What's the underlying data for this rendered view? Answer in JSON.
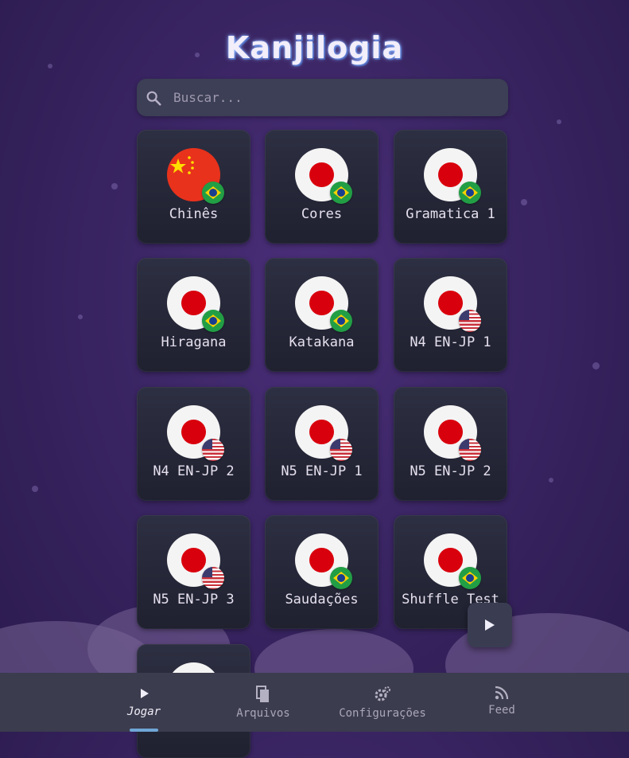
{
  "app": {
    "title": "Kanjilogia"
  },
  "search": {
    "placeholder": "Buscar..."
  },
  "decks": [
    {
      "label": "Chinês",
      "main_flag": "china-flag",
      "badge": "brazil-flag"
    },
    {
      "label": "Cores",
      "main_flag": "japan-flag",
      "badge": "brazil-flag"
    },
    {
      "label": "Gramatica 1",
      "main_flag": "japan-flag",
      "badge": "brazil-flag"
    },
    {
      "label": "Hiragana",
      "main_flag": "japan-flag",
      "badge": "brazil-flag"
    },
    {
      "label": "Katakana",
      "main_flag": "japan-flag",
      "badge": "brazil-flag"
    },
    {
      "label": "N4 EN-JP 1",
      "main_flag": "japan-flag",
      "badge": "usa-flag"
    },
    {
      "label": "N4 EN-JP 2",
      "main_flag": "japan-flag",
      "badge": "usa-flag"
    },
    {
      "label": "N5 EN-JP 1",
      "main_flag": "japan-flag",
      "badge": "usa-flag"
    },
    {
      "label": "N5 EN-JP 2",
      "main_flag": "japan-flag",
      "badge": "usa-flag"
    },
    {
      "label": "N5 EN-JP 3",
      "main_flag": "japan-flag",
      "badge": "usa-flag"
    },
    {
      "label": "Saudações",
      "main_flag": "japan-flag",
      "badge": "brazil-flag"
    },
    {
      "label": "Shuffle Test",
      "main_flag": "japan-flag",
      "badge": "brazil-flag"
    },
    {
      "label": "",
      "main_flag": "japan-flag",
      "badge": ""
    }
  ],
  "fab": {
    "icon": "play-icon"
  },
  "nav": {
    "items": [
      {
        "label": "Jogar",
        "icon": "play-icon",
        "active": true
      },
      {
        "label": "Arquivos",
        "icon": "files-icon",
        "active": false
      },
      {
        "label": "Configurações",
        "icon": "settings-icon",
        "active": false
      },
      {
        "label": "Feed",
        "icon": "rss-icon",
        "active": false
      }
    ]
  },
  "colors": {
    "background": "#3a2563",
    "card": "#262838",
    "navbar": "#3b3c4e",
    "accent": "#6fa6d6"
  }
}
